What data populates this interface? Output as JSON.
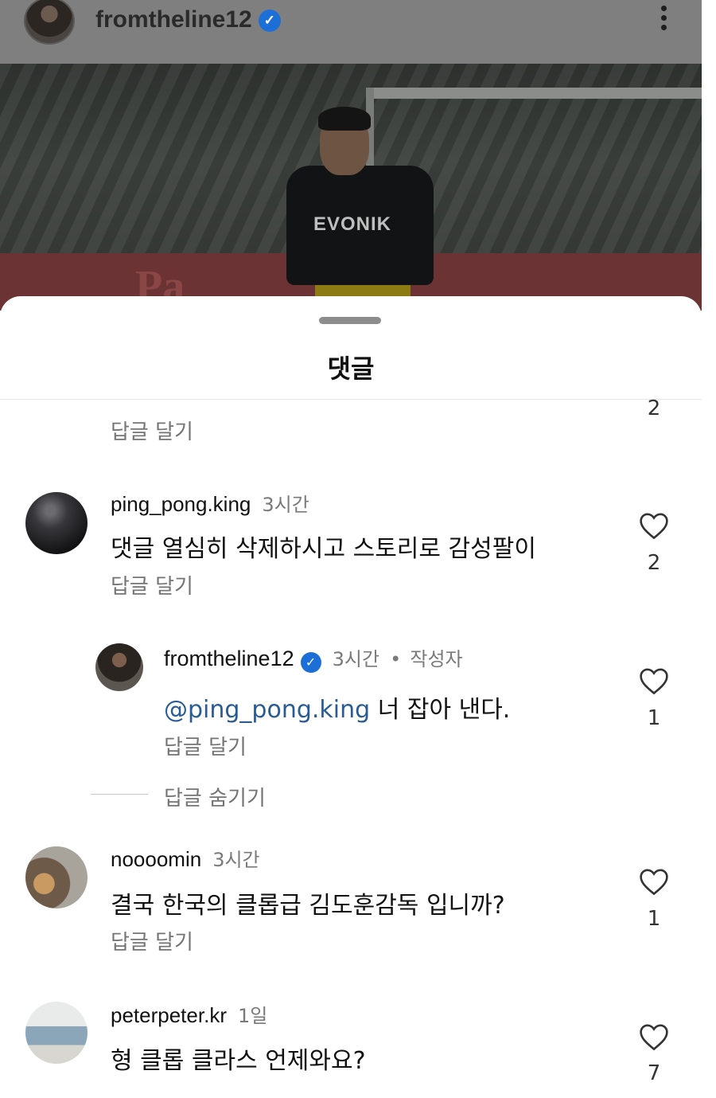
{
  "post": {
    "username": "fromtheline12",
    "verified_glyph": "✓",
    "more_icon": "more-vertical-icon",
    "photo_logo": "EVONIK",
    "photo_board": "Pa"
  },
  "sheet": {
    "title": "댓글"
  },
  "top_partial": {
    "reply_label": "답글 달기",
    "like_count": "2"
  },
  "comments": [
    {
      "username": "ping_pong.king",
      "time": "3시간",
      "text": "댓글 열심히 삭제하시고 스토리로 감성팔이",
      "reply_label": "답글 달기",
      "like_count": "2"
    },
    {
      "username": "noooomin",
      "time": "3시간",
      "text": "결국 한국의 클롭급 김도훈감독 입니까?",
      "reply_label": "답글 달기",
      "like_count": "1"
    },
    {
      "username": "peterpeter.kr",
      "time": "1일",
      "text": "형 클롭 클라스 언제와요?",
      "like_count": "7"
    }
  ],
  "reply": {
    "username": "fromtheline12",
    "verified_glyph": "✓",
    "time": "3시간",
    "separator": "•",
    "author_badge": "작성자",
    "mention": "@ping_pong.king",
    "text": " 너 잡아 낸다.",
    "reply_label": "답글 달기",
    "like_count": "1"
  },
  "hide_replies_label": "답글 숨기기",
  "colors": {
    "verified": "#1d6fd8",
    "mention": "#2a5b95",
    "secondary_text": "#747474"
  }
}
